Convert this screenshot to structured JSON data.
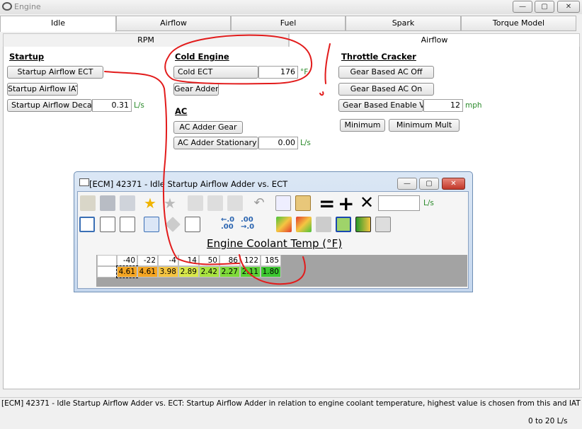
{
  "window": {
    "title": "Engine",
    "minimize": "—",
    "maximize": "▢",
    "close": "✕"
  },
  "tabs": [
    "Idle",
    "Airflow",
    "Fuel",
    "Spark",
    "Torque Model"
  ],
  "subtabs": [
    "RPM",
    "Airflow"
  ],
  "startup": {
    "heading": "Startup",
    "airflow_ect": "Startup Airflow ECT",
    "airflow_iat": "Startup Airflow IAT",
    "decay_label": "Startup Airflow Decay",
    "decay_value": "0.31",
    "decay_unit": "L/s"
  },
  "cold_engine": {
    "heading": "Cold Engine",
    "ect_label": "Cold ECT",
    "ect_value": "176",
    "ect_unit": "°F",
    "gear_adder": "Gear Adder"
  },
  "ac": {
    "heading": "AC",
    "adder_gear": "AC Adder Gear",
    "stationary_label": "AC Adder Stationary Min",
    "stationary_value": "0.00",
    "stationary_unit": "L/s"
  },
  "throttle": {
    "heading": "Throttle Cracker",
    "ac_off": "Gear Based AC Off",
    "ac_on": "Gear Based AC On",
    "vss_label": "Gear Based Enable VSS",
    "vss_value": "12",
    "vss_unit": "mph",
    "minimum": "Minimum",
    "minimum_mult": "Minimum Mult"
  },
  "popup": {
    "title": "[ECM] 42371 - Idle Startup Airflow Adder vs. ECT",
    "unit": "L/s",
    "input_value": "",
    "axis_title": "Engine Coolant Temp (°F)",
    "columns": [
      "-40",
      "-22",
      "-4",
      "14",
      "50",
      "86",
      "122",
      "185"
    ],
    "values": [
      "4.61",
      "4.61",
      "3.98",
      "2.89",
      "2.42",
      "2.27",
      "2.11",
      "1.80"
    ],
    "cell_colors": [
      "#f5a623",
      "#f5a623",
      "#f5c542",
      "#d9e84a",
      "#a8e33f",
      "#7fdb3a",
      "#5ad235",
      "#3cc830"
    ]
  },
  "status": {
    "description": "[ECM] 42371 - Idle Startup Airflow Adder vs. ECT: Startup Airflow Adder in relation to engine coolant temperature, highest value is chosen from this and IAT based table.",
    "range": "0 to 20 L/s"
  }
}
